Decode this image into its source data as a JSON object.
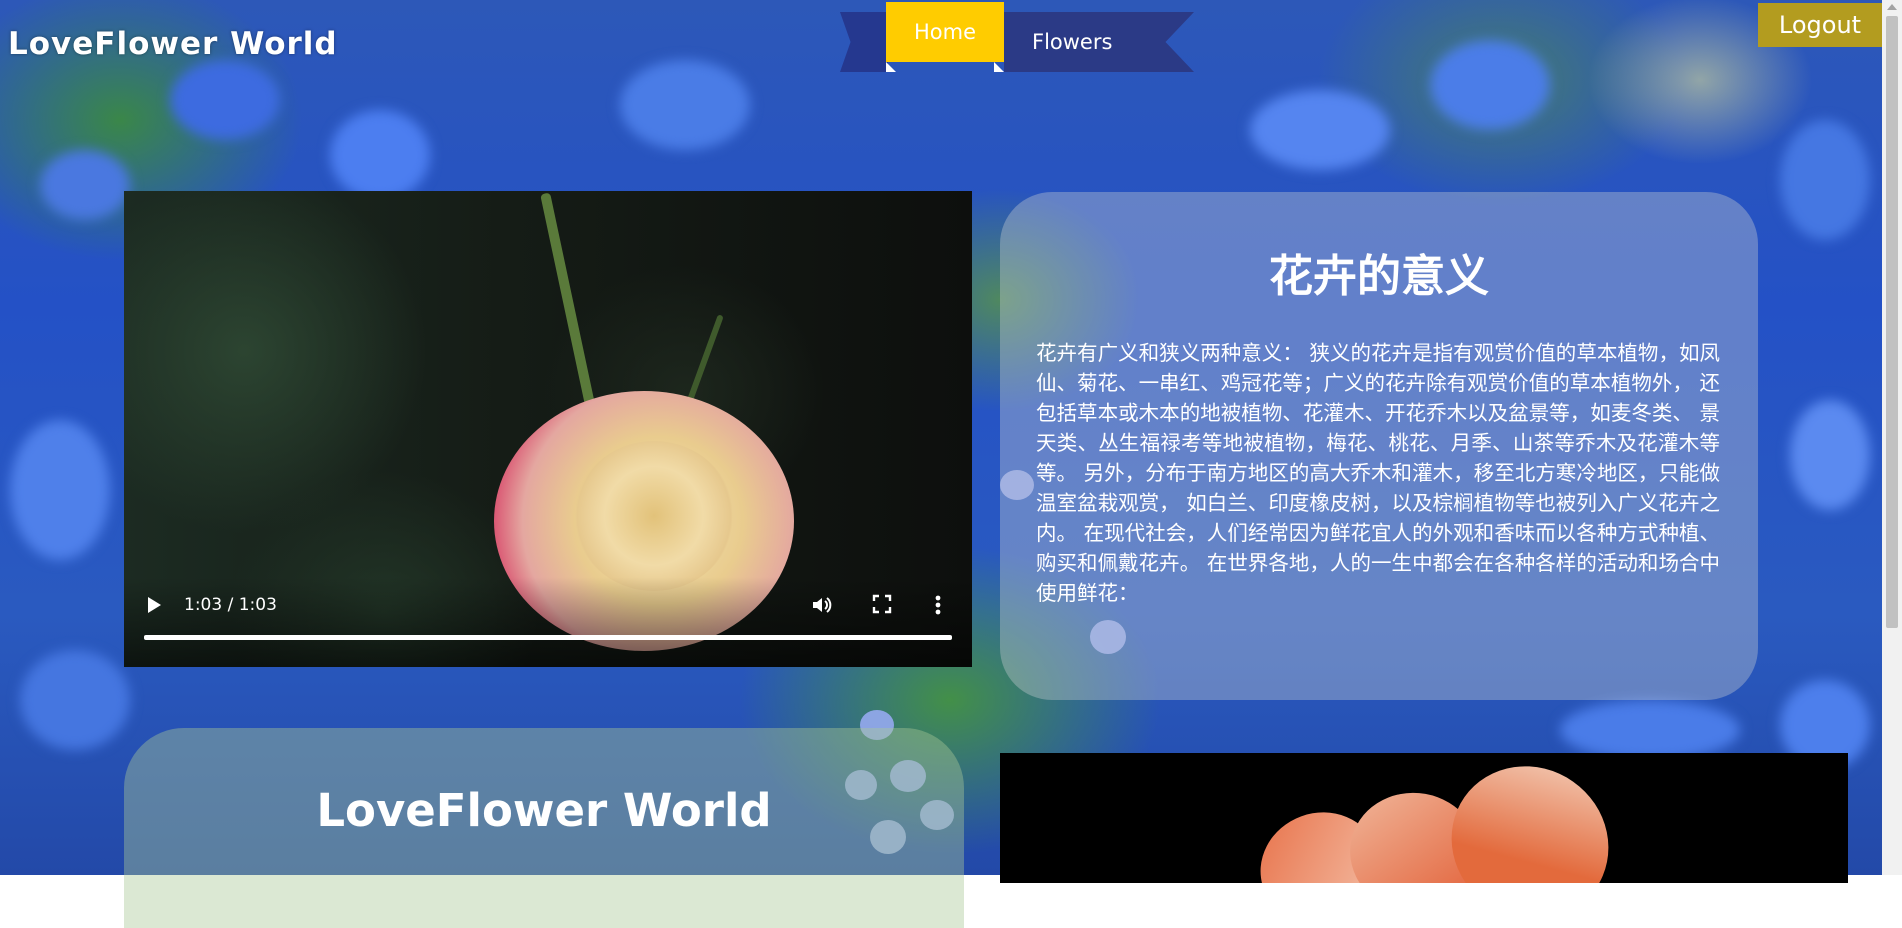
{
  "header": {
    "brand": "LoveFlower World",
    "nav": [
      {
        "label": "Home"
      },
      {
        "label": "Flowers"
      }
    ],
    "logout_label": "Logout"
  },
  "video": {
    "time": "1:03 / 1:03",
    "progress_fraction": 1.0,
    "icons": [
      "play-icon",
      "volume-icon",
      "fullscreen-icon",
      "more-options-icon"
    ]
  },
  "info_card": {
    "title": "花卉的意义",
    "body": "花卉有广义和狭义两种意义： 狭义的花卉是指有观赏价值的草本植物，如凤仙、菊花、一串红、鸡冠花等；广义的花卉除有观赏价值的草本植物外， 还包括草本或木本的地被植物、花灌木、开花乔木以及盆景等，如麦冬类、 景天类、丛生福禄考等地被植物，梅花、桃花、月季、山茶等乔木及花灌木等等。 另外，分布于南方地区的高大乔木和灌木，移至北方寒冷地区，只能做温室盆栽观赏， 如白兰、印度橡皮树，以及棕榈植物等也被列入广义花卉之内。 在现代社会，人们经常因为鲜花宜人的外观和香味而以各种方式种植、购买和佩戴花卉。 在世界各地，人的一生中都会在各种各样的活动和场合中使用鲜花："
  },
  "second_card": {
    "title": "LoveFlower World"
  },
  "colors": {
    "home_active": "#ffcc00",
    "nav_ribbon": "#2b3a86",
    "logout_bg": "#b39c1f"
  }
}
